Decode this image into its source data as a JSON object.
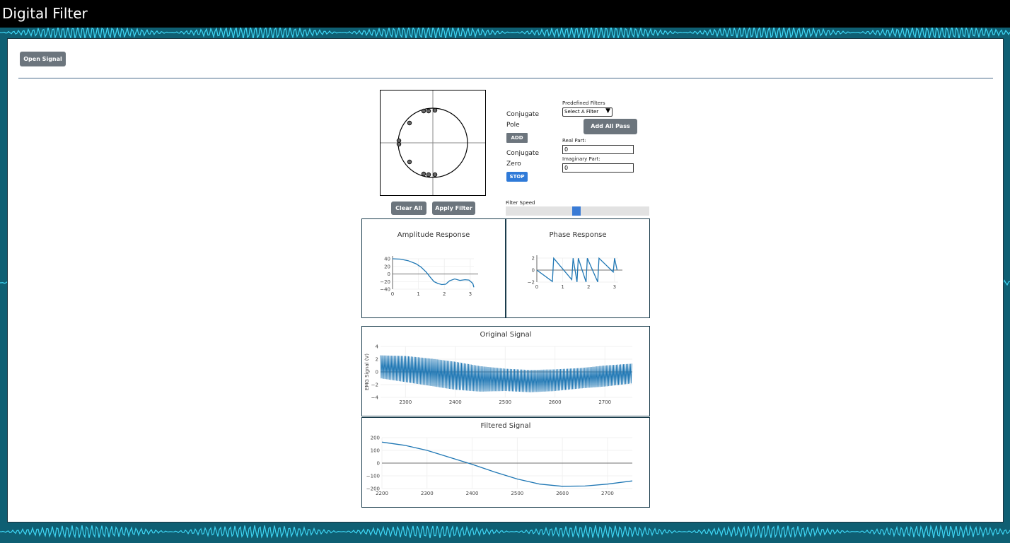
{
  "header": {
    "title": "Digital Filter"
  },
  "toolbar": {
    "open_signal_label": "Open Signal"
  },
  "zplane": {
    "clear_all_label": "Clear All",
    "apply_filter_label": "Apply Filter",
    "conjugate_pole_label_1": "Conjugate",
    "conjugate_pole_label_2": "Pole",
    "add_label": "ADD",
    "conjugate_zero_label_1": "Conjugate",
    "conjugate_zero_label_2": "Zero",
    "stop_label": "STOP"
  },
  "filters": {
    "predefined_label": "Predefined Filters",
    "select_value": "Select A Filter",
    "add_all_pass_label": "Add All Pass",
    "real_part_label": "Real Part:",
    "real_part_value": "0",
    "imag_part_label": "Imaginary Part:",
    "imag_part_value": "0"
  },
  "speed": {
    "label": "Filter Speed",
    "value_fraction": 0.49
  },
  "chart_data": [
    {
      "type": "line",
      "title": "Amplitude Response",
      "xlim": [
        0,
        3.14
      ],
      "ylim": [
        -40,
        40
      ],
      "x_ticks": [
        "0",
        "1",
        "2",
        "3"
      ],
      "y_ticks": [
        "40",
        "20",
        "0",
        "−20",
        "−40"
      ],
      "x": [
        0,
        0.3,
        0.6,
        0.9,
        1.1,
        1.3,
        1.45,
        1.6,
        1.75,
        1.9,
        2.05,
        2.2,
        2.4,
        2.6,
        2.8,
        2.95,
        3.1,
        3.14
      ],
      "values": [
        40,
        39,
        35,
        27,
        18,
        5,
        -8,
        -20,
        -25,
        -28,
        -27,
        -18,
        -13,
        -17,
        -15,
        -16,
        -25,
        -35
      ]
    },
    {
      "type": "line",
      "title": "Phase Response",
      "xlim": [
        0,
        3.14
      ],
      "ylim": [
        -3.14,
        3.14
      ],
      "x_ticks": [
        "0",
        "1",
        "2",
        "3"
      ],
      "y_ticks": [
        "2",
        "0",
        "−2"
      ],
      "x": [
        0,
        0.6,
        0.65,
        1.35,
        1.4,
        1.55,
        1.6,
        1.9,
        1.95,
        2.35,
        2.4,
        2.95,
        3.0,
        3.1
      ],
      "values": [
        0,
        -3.0,
        3.1,
        -2.5,
        3.1,
        -3.1,
        3.1,
        -3.1,
        3.1,
        -3.1,
        3.1,
        -0.5,
        3.1,
        0
      ]
    },
    {
      "type": "line",
      "title": "Original Signal",
      "ylabel": "EMG Signal (V)",
      "xlim": [
        2250,
        2755
      ],
      "ylim": [
        -4,
        4
      ],
      "x_ticks": [
        "2300",
        "2400",
        "2500",
        "2600",
        "2700"
      ],
      "y_ticks": [
        "4",
        "2",
        "0",
        "−2",
        "−4"
      ],
      "envelope": {
        "x": [
          2250,
          2300,
          2350,
          2400,
          2450,
          2500,
          2550,
          2600,
          2650,
          2700,
          2755
        ],
        "upper": [
          2.6,
          2.5,
          2.1,
          1.6,
          0.9,
          0.5,
          0.3,
          0.4,
          0.6,
          1.0,
          1.3
        ],
        "lower": [
          -1.0,
          -1.6,
          -2.2,
          -2.8,
          -3.1,
          -3.0,
          -3.2,
          -3.0,
          -2.6,
          -2.3,
          -1.8
        ]
      }
    },
    {
      "type": "line",
      "title": "Filtered Signal",
      "xlim": [
        2200,
        2755
      ],
      "ylim": [
        -200,
        200
      ],
      "x_ticks": [
        "2200",
        "2300",
        "2400",
        "2500",
        "2600",
        "2700"
      ],
      "y_ticks": [
        "200",
        "100",
        "0",
        "−100",
        "−200"
      ],
      "x": [
        2200,
        2250,
        2300,
        2350,
        2400,
        2450,
        2500,
        2550,
        2600,
        2650,
        2700,
        2755
      ],
      "values": [
        165,
        140,
        100,
        45,
        -10,
        -70,
        -125,
        -165,
        -182,
        -180,
        -165,
        -140
      ]
    }
  ]
}
